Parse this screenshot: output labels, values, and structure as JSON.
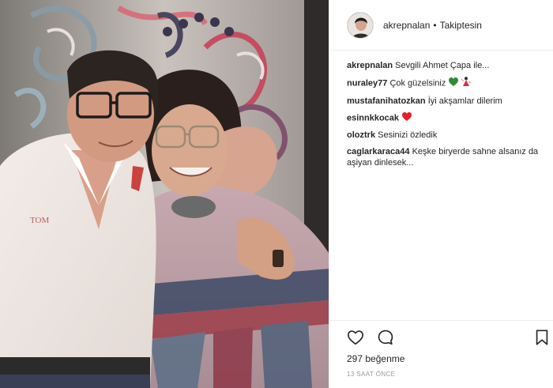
{
  "post": {
    "author": "akrepnalan",
    "separator": "•",
    "follow_status": "Takiptesin",
    "caption": {
      "user": "akrepnalan",
      "text": "Sevgili Ahmet Çapa ile..."
    }
  },
  "comments": [
    {
      "user": "nuraley77",
      "text": "Çok güzelsiniz",
      "emoji": [
        "green-heart-icon",
        "dancer-icon"
      ]
    },
    {
      "user": "mustafanihatozkan",
      "text": "İyi akşamlar dilerim",
      "emoji": []
    },
    {
      "user": "esinnkkocak",
      "text": "",
      "emoji": [
        "red-heart-icon"
      ]
    },
    {
      "user": "oloztrk",
      "text": "Sesinizi özledik",
      "emoji": []
    },
    {
      "user": "caglarkaraca44",
      "text": "Keşke biryerde sahne alsanız da aşiyan dinlesek...",
      "emoji": []
    }
  ],
  "footer": {
    "likes_count": "297",
    "likes_label": "beğenme",
    "timestamp": "13 SAAT ÖNCE"
  },
  "colors": {
    "text": "#262626",
    "muted": "#999999",
    "divider": "#efefef",
    "red_heart": "#ed1c24",
    "green_heart": "#2e8b3a"
  }
}
